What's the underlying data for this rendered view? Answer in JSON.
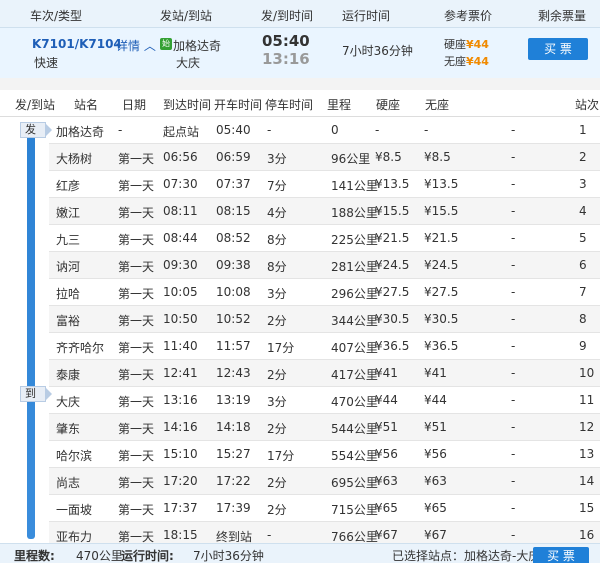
{
  "header": {
    "columns": [
      "车次/类型",
      "发站/到站",
      "发/到时间",
      "运行时间",
      "参考票价",
      "剩余票量"
    ]
  },
  "train": {
    "code": "K7101/K7104",
    "detail_label": "详情",
    "type": "快速",
    "origin_badge": "始",
    "from": "加格达奇",
    "to": "大庆",
    "depart_time": "05:40",
    "arrive_time": "13:16",
    "duration": "7小时36分钟",
    "price_hard_seat_label": "硬座",
    "price_hard_seat": "¥44",
    "price_no_seat_label": "无座",
    "price_no_seat": "¥44",
    "buy_label": "买 票"
  },
  "table": {
    "columns": [
      "发/到站",
      "站名",
      "日期",
      "到达时间",
      "开车时间",
      "停车时间",
      "里程",
      "硬座",
      "无座",
      "",
      "站次"
    ],
    "rows": [
      [
        "",
        "加格达奇",
        "-",
        "起点站",
        "05:40",
        "-",
        "0",
        "-",
        "-",
        "-",
        "1"
      ],
      [
        "",
        "大杨树",
        "第一天",
        "06:56",
        "06:59",
        "3分",
        "96公里",
        "¥8.5",
        "¥8.5",
        "-",
        "2"
      ],
      [
        "",
        "红彦",
        "第一天",
        "07:30",
        "07:37",
        "7分",
        "141公里",
        "¥13.5",
        "¥13.5",
        "-",
        "3"
      ],
      [
        "",
        "嫩江",
        "第一天",
        "08:11",
        "08:15",
        "4分",
        "188公里",
        "¥15.5",
        "¥15.5",
        "-",
        "4"
      ],
      [
        "",
        "九三",
        "第一天",
        "08:44",
        "08:52",
        "8分",
        "225公里",
        "¥21.5",
        "¥21.5",
        "-",
        "5"
      ],
      [
        "",
        "讷河",
        "第一天",
        "09:30",
        "09:38",
        "8分",
        "281公里",
        "¥24.5",
        "¥24.5",
        "-",
        "6"
      ],
      [
        "",
        "拉哈",
        "第一天",
        "10:05",
        "10:08",
        "3分",
        "296公里",
        "¥27.5",
        "¥27.5",
        "-",
        "7"
      ],
      [
        "",
        "富裕",
        "第一天",
        "10:50",
        "10:52",
        "2分",
        "344公里",
        "¥30.5",
        "¥30.5",
        "-",
        "8"
      ],
      [
        "",
        "齐齐哈尔",
        "第一天",
        "11:40",
        "11:57",
        "17分",
        "407公里",
        "¥36.5",
        "¥36.5",
        "-",
        "9"
      ],
      [
        "",
        "泰康",
        "第一天",
        "12:41",
        "12:43",
        "2分",
        "417公里",
        "¥41",
        "¥41",
        "-",
        "10"
      ],
      [
        "",
        "大庆",
        "第一天",
        "13:16",
        "13:19",
        "3分",
        "470公里",
        "¥44",
        "¥44",
        "-",
        "11"
      ],
      [
        "",
        "肇东",
        "第一天",
        "14:16",
        "14:18",
        "2分",
        "544公里",
        "¥51",
        "¥51",
        "-",
        "12"
      ],
      [
        "",
        "哈尔滨",
        "第一天",
        "15:10",
        "15:27",
        "17分",
        "554公里",
        "¥56",
        "¥56",
        "-",
        "13"
      ],
      [
        "",
        "尚志",
        "第一天",
        "17:20",
        "17:22",
        "2分",
        "695公里",
        "¥63",
        "¥63",
        "-",
        "14"
      ],
      [
        "",
        "一面坡",
        "第一天",
        "17:37",
        "17:39",
        "2分",
        "715公里",
        "¥65",
        "¥65",
        "-",
        "15"
      ],
      [
        "",
        "亚布力",
        "第一天",
        "18:15",
        "终到站",
        "-",
        "766公里",
        "¥67",
        "¥67",
        "-",
        "16"
      ]
    ],
    "depart_tag": "发",
    "arrive_tag": "到"
  },
  "footer": {
    "mileage_label": "里程数:",
    "mileage_value": "470公里",
    "runtime_label": "运行时间:",
    "runtime_value": "7小时36分钟",
    "selected_text": "已选择站点：加格达奇-大庆",
    "buy_label": "买 票"
  },
  "colors": {
    "accent": "#1f80d8",
    "price": "#f08a00",
    "header_bg": "#eaf3fb"
  }
}
